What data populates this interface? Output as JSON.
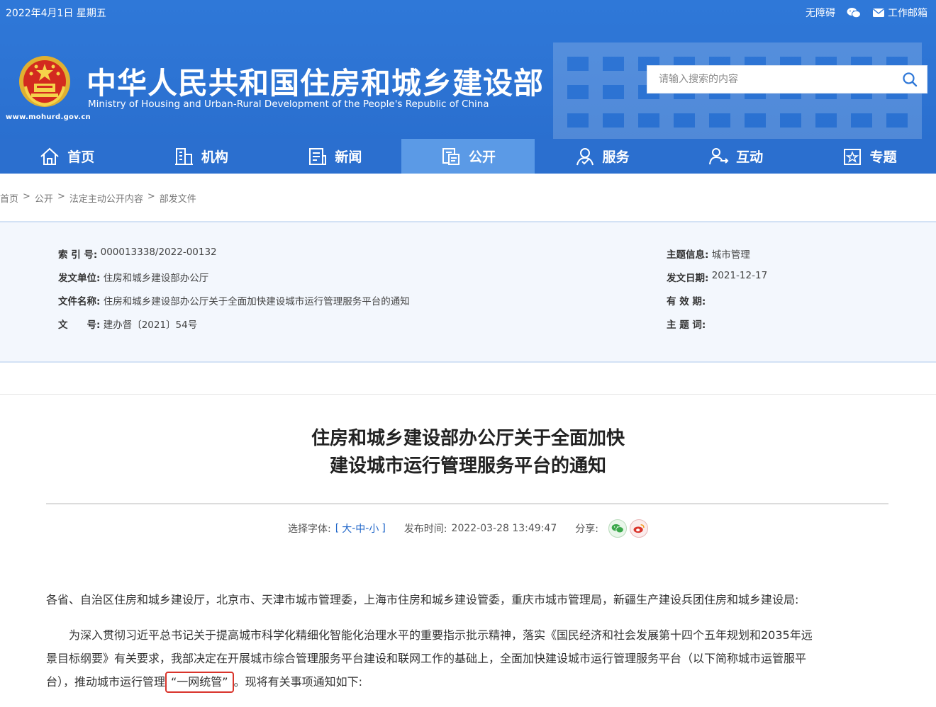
{
  "topbar": {
    "date": "2022年4月1日 星期五",
    "accessibility": "无障碍",
    "mailbox": "工作邮箱"
  },
  "site": {
    "title_cn": "中华人民共和国住房和城乡建设部",
    "title_en": "Ministry of Housing and Urban-Rural Development of the People's Republic of China",
    "url": "www.mohurd.gov.cn"
  },
  "search": {
    "placeholder": "请输入搜索的内容"
  },
  "nav": {
    "items": [
      {
        "label": "首页",
        "icon": "home-icon"
      },
      {
        "label": "机构",
        "icon": "building-icon"
      },
      {
        "label": "新闻",
        "icon": "news-icon"
      },
      {
        "label": "公开",
        "icon": "document-icon"
      },
      {
        "label": "服务",
        "icon": "service-icon"
      },
      {
        "label": "互动",
        "icon": "interact-icon"
      },
      {
        "label": "专题",
        "icon": "topic-icon"
      }
    ],
    "active": "公开"
  },
  "breadcrumb": {
    "items": [
      "首页",
      "公开",
      "法定主动公开内容",
      "部发文件"
    ],
    "separator": ">"
  },
  "info": {
    "index_label": "索 引 号:",
    "index_value": "000013338/2022-00132",
    "issuer_label": "发文单位:",
    "issuer_value": "住房和城乡建设部办公厅",
    "filename_label": "文件名称:",
    "filename_value": "住房和城乡建设部办公厅关于全面加快建设城市运行管理服务平台的通知",
    "docno_label": "文　　号:",
    "docno_value": "建办督〔2021〕54号",
    "topic_label": "主题信息:",
    "topic_value": "城市管理",
    "date_label": "发文日期:",
    "date_value": "2021-12-17",
    "valid_label": "有 效 期:",
    "valid_value": "",
    "keyword_label": "主 题 词:",
    "keyword_value": ""
  },
  "article": {
    "title_line1": "住房和城乡建设部办公厅关于全面加快",
    "title_line2": "建设城市运行管理服务平台的通知",
    "font_label": "选择字体:",
    "font_open": "[",
    "font_large": "大",
    "font_medium": "中",
    "font_small": "小",
    "font_sep": "-",
    "font_close": "]",
    "publish_label": "发布时间:",
    "publish_time": "2022-03-28 13:49:47",
    "share_label": "分享:",
    "salutation": "各省、自治区住房和城乡建设厅，北京市、天津市城市管理委，上海市住房和城乡建设管委，重庆市城市管理局，新疆生产建设兵团住房和城乡建设局:",
    "body_line1": "为深入贯彻习近平总书记关于提高城市科学化精细化智能化治理水平的重要指示批示精神，落实《国民经济和社会发展第十四个五年规划和2035年远",
    "body_line2": "景目标纲要》有关要求，我部决定在开展城市综合管理服务平台建设和联网工作的基础上，全面加快建设城市运行管理服务平台（以下简称城市运管服平",
    "body_line3_a": "台），推动城市运行管理",
    "body_line3_highlight": "“一网统管”",
    "body_line3_b": "。现将有关事项通知如下:"
  }
}
